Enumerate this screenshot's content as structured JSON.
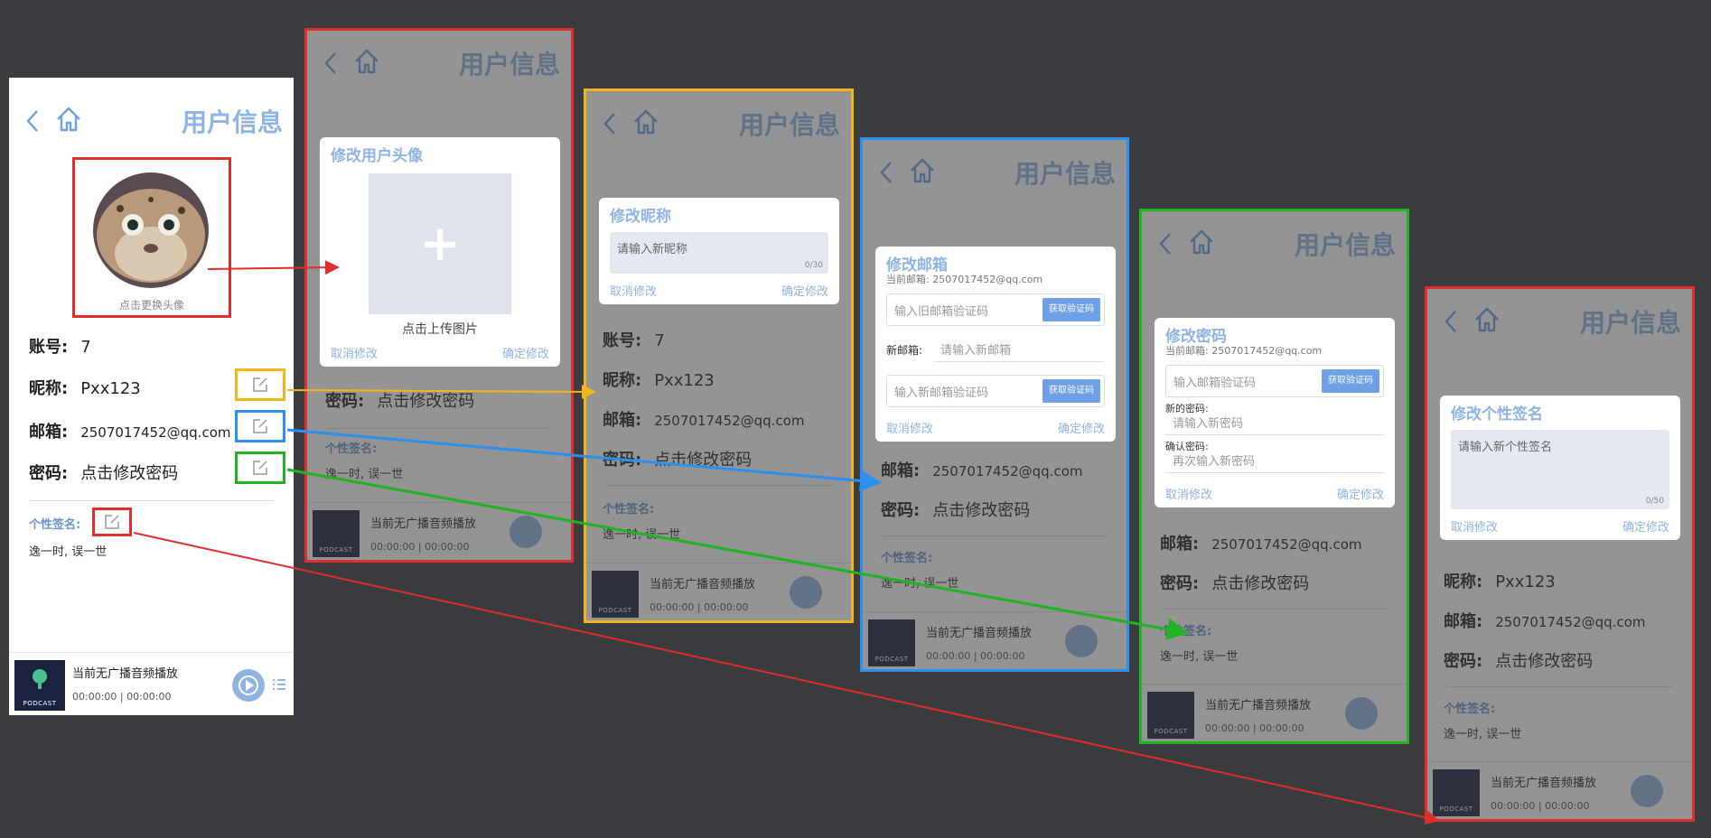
{
  "header": {
    "title": "用户信息"
  },
  "avatar": {
    "caption": "点击更换头像"
  },
  "fields": {
    "account_label": "账号:",
    "account_value": "7",
    "nickname_label": "昵称:",
    "nickname_value": "Pxx123",
    "email_label": "邮箱:",
    "email_value": "2507017452@qq.com",
    "password_label": "密码:",
    "password_value": "点击修改密码"
  },
  "signature": {
    "label": "个性签名:",
    "text": "逸一时, 误一世"
  },
  "player": {
    "title": "当前无广播音频播放",
    "time": "00:00:00 | 00:00:00",
    "cover_text": "PODCAST"
  },
  "modal_avatar": {
    "title": "修改用户头像",
    "upload_caption": "点击上传图片",
    "cancel": "取消修改",
    "confirm": "确定修改"
  },
  "modal_nickname": {
    "title": "修改昵称",
    "placeholder": "请输入新昵称",
    "counter": "0/30",
    "cancel": "取消修改",
    "confirm": "确定修改"
  },
  "modal_email": {
    "title": "修改邮箱",
    "current": "当前邮箱: 2507017452@qq.com",
    "old_code_placeholder": "输入旧邮箱验证码",
    "get_code": "获取验证码",
    "new_email_label": "新邮箱:",
    "new_email_placeholder": "请输入新邮箱",
    "new_code_placeholder": "输入新邮箱验证码",
    "cancel": "取消修改",
    "confirm": "确定修改"
  },
  "modal_password": {
    "title": "修改密码",
    "current": "当前邮箱: 2507017452@qq.com",
    "code_placeholder": "输入邮箱验证码",
    "get_code": "获取验证码",
    "new_label": "新的密码:",
    "new_placeholder": "请输入新密码",
    "confirm_label": "确认密码:",
    "confirm_placeholder": "再次输入新密码",
    "cancel": "取消修改",
    "confirm": "确定修改"
  },
  "modal_signature": {
    "title": "修改个性签名",
    "placeholder": "请输入新个性签名",
    "counter": "0/50",
    "cancel": "取消修改",
    "confirm": "确定修改"
  },
  "colors": {
    "accent": "#8fb3e3",
    "red": "#e02d2d",
    "yellow": "#f2b51b",
    "blue": "#2d8ff0",
    "green": "#22b322",
    "background": "#3b3c40"
  }
}
